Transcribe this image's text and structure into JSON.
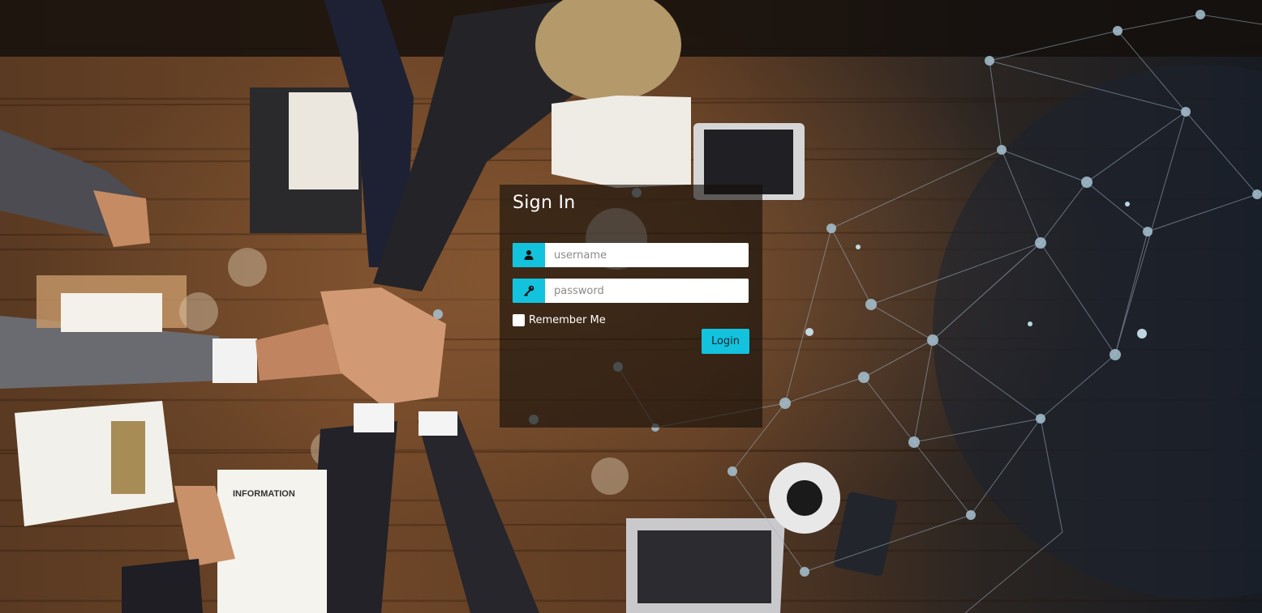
{
  "background": {
    "description_icon": "team-handstack-photo",
    "accent": "#13c2dd"
  },
  "login": {
    "title": "Sign In",
    "username_placeholder": "username",
    "username_value": "",
    "password_placeholder": "password",
    "password_value": "",
    "remember_label": "Remember Me",
    "remember_checked": false,
    "button_label": "Login",
    "username_icon": "user-icon",
    "password_icon": "key-icon"
  },
  "photo_text": {
    "document_heading": "INFORMATION"
  }
}
